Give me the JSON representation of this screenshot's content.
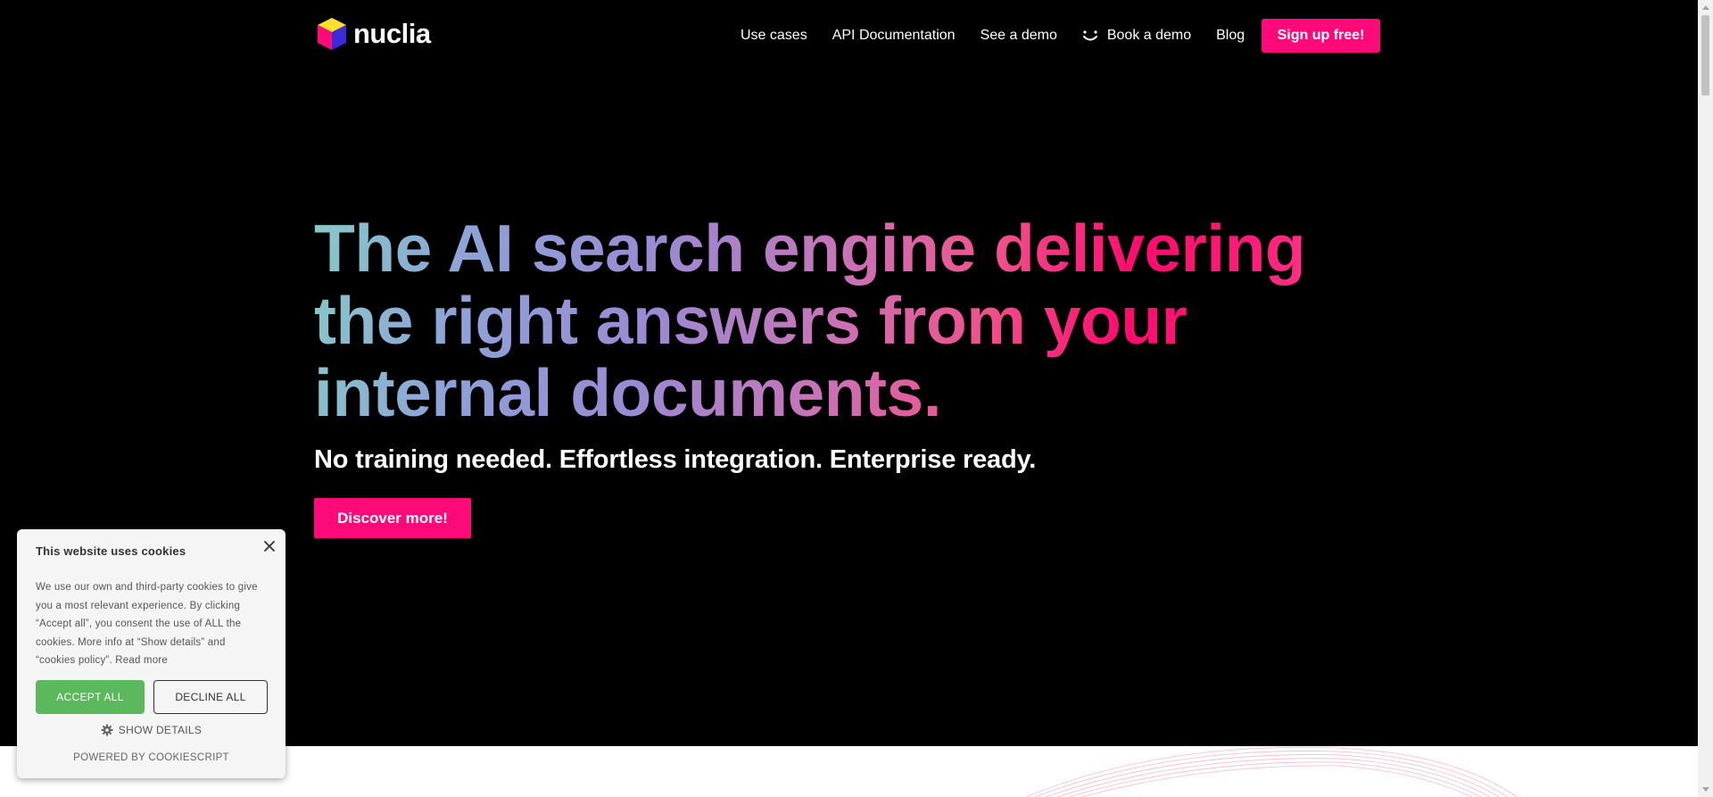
{
  "brand": {
    "name": "nuclia",
    "accent_color": "#ff0a78"
  },
  "header": {
    "nav": [
      {
        "label": "Use cases"
      },
      {
        "label": "API Documentation"
      },
      {
        "label": "See a demo"
      },
      {
        "label": "Book a demo",
        "icon": "smile-icon"
      },
      {
        "label": "Blog"
      }
    ],
    "signup_label": "Sign up free!"
  },
  "hero": {
    "headline": "The AI search engine delivering the right answers from your internal documents.",
    "subline": "No training needed. Effortless integration. Enterprise ready.",
    "cta_label": "Discover more!"
  },
  "cookie_banner": {
    "title": "This website uses cookies",
    "body": "We use our own and third-party cookies to give you a most relevant experience. By clicking “Accept all”, you consent the use of ALL the cookies. More info at “Show details” and “cookies policy”.",
    "read_more": "Read more",
    "accept_label": "ACCEPT ALL",
    "decline_label": "DECLINE ALL",
    "show_details_label": "SHOW DETAILS",
    "powered_by": "POWERED BY COOKIESCRIPT",
    "accept_color": "#5cb85c"
  }
}
